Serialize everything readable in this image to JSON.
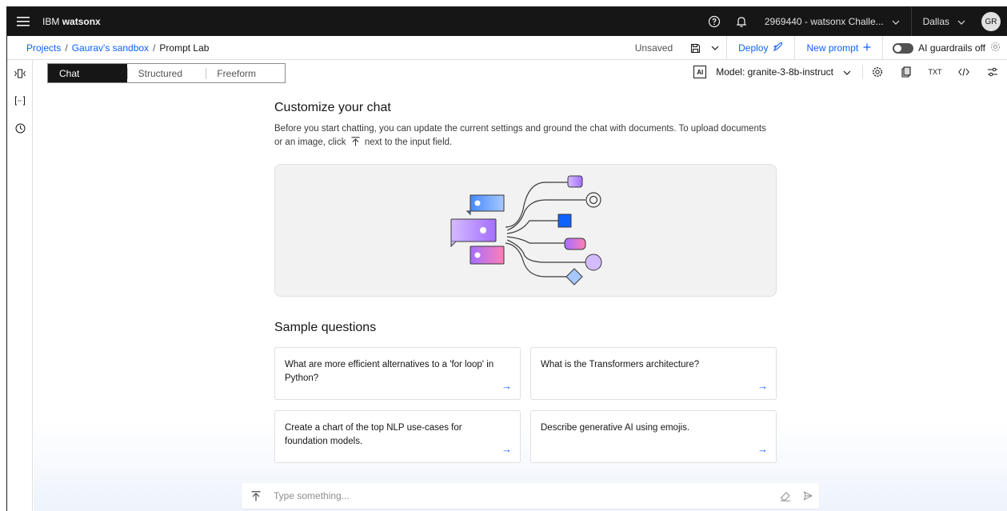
{
  "topbar": {
    "brand_prefix": "IBM",
    "brand_name": "watsonx",
    "account": "2969440 - watsonx Challe...",
    "region": "Dallas",
    "avatar": "GR"
  },
  "breadcrumb": {
    "items": [
      "Projects",
      "Gaurav's sandbox",
      "Prompt Lab"
    ],
    "separator": "/"
  },
  "actions": {
    "status": "Unsaved",
    "deploy": "Deploy",
    "new_prompt": "New prompt",
    "guardrails": "AI guardrails off"
  },
  "tabs": [
    "Chat",
    "Structured",
    "Freeform"
  ],
  "model": {
    "badge": "AI",
    "label": "Model: granite-3-8b-instruct",
    "txt_icon": "TXT"
  },
  "main": {
    "heading": "Customize your chat",
    "description_part1": "Before you start chatting, you can update the current settings and ground the chat with documents. To upload documents or an image, click",
    "description_part2": "next to the input field.",
    "sample_title": "Sample questions",
    "samples": [
      "What are more efficient alternatives to a 'for loop' in Python?",
      "What is the Transformers architecture?",
      "Create a chart of the top NLP use-cases for foundation models.",
      "Describe generative AI using emojis."
    ],
    "arrow": "→"
  },
  "input": {
    "placeholder": "Type something..."
  },
  "colors": {
    "accent": "#0f62fe",
    "topbar_bg": "#161616",
    "purple": "#a56eff",
    "pink": "#ff7eb6"
  }
}
